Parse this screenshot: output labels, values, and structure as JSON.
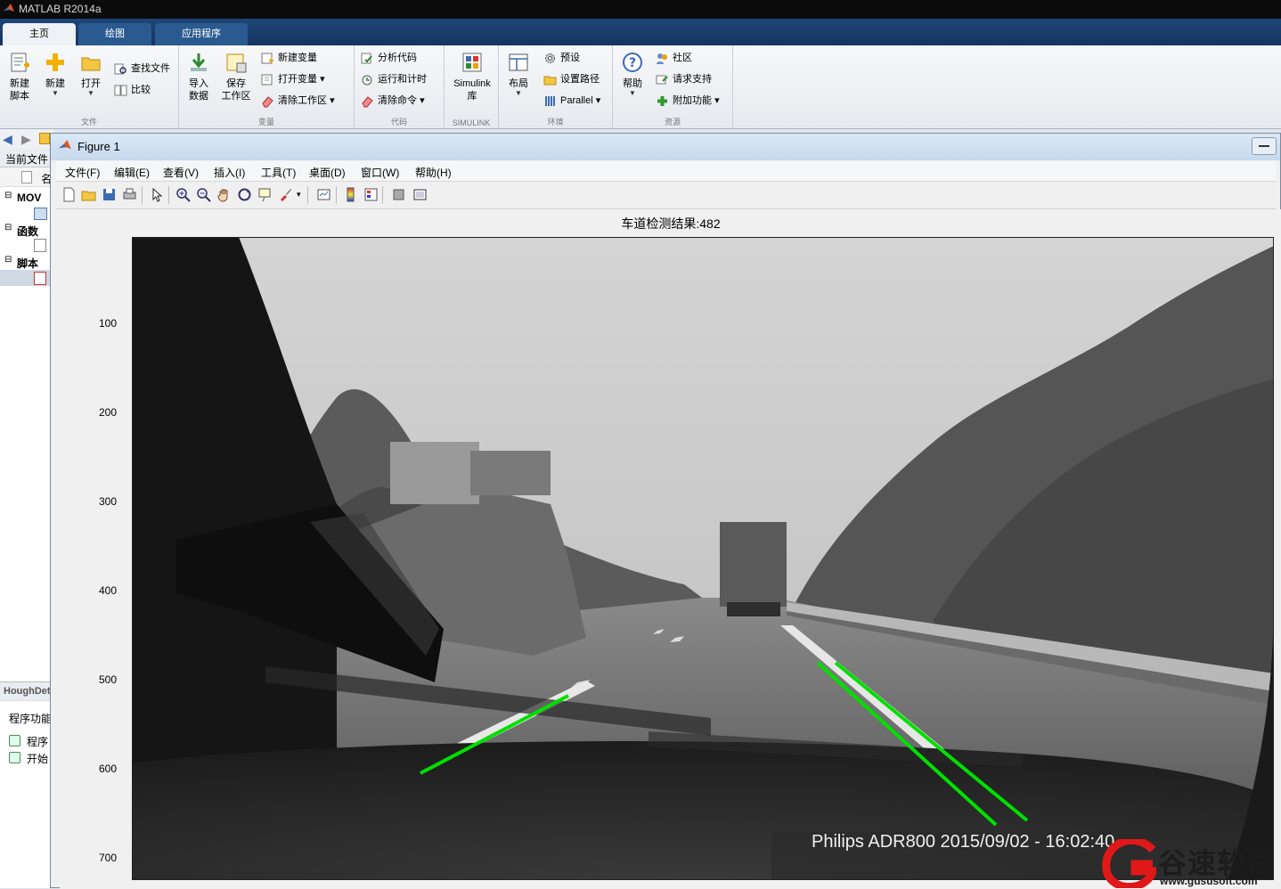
{
  "app": {
    "title": "MATLAB R2014a"
  },
  "tabs": [
    {
      "label": "主页"
    },
    {
      "label": "绘图"
    },
    {
      "label": "应用程序"
    }
  ],
  "ribbon": {
    "file": {
      "label": "文件",
      "new_script": "新建\n脚本",
      "new": "新建",
      "open": "打开",
      "find_files": "查找文件",
      "compare": "比较"
    },
    "variable": {
      "label": "变量",
      "import": "导入\n数据",
      "save": "保存\n工作区",
      "new_var": "新建变量",
      "open_var": "打开变量",
      "clear_ws": "清除工作区"
    },
    "code": {
      "label": "代码",
      "analyze": "分析代码",
      "run_time": "运行和计时",
      "clear_cmd": "清除命令"
    },
    "simulink": {
      "label": "SIMULINK",
      "btn": "Simulink\n库"
    },
    "environment": {
      "label": "环境",
      "layout": "布局",
      "prefs": "预设",
      "set_path": "设置路径",
      "parallel": "Parallel"
    },
    "resources": {
      "label": "资源",
      "help": "帮助",
      "community": "社区",
      "support": "请求支持",
      "addons": "附加功能"
    }
  },
  "left_panel": {
    "header": "当前文件",
    "col_name": "名",
    "folder": "MOV",
    "functions": "函数",
    "scripts": "脚本",
    "detail_title": "HoughDet",
    "detail_sub": "程序功能",
    "item1": "程序",
    "item2": "开始"
  },
  "figure": {
    "title": "Figure 1",
    "menu": [
      "文件(F)",
      "编辑(E)",
      "查看(V)",
      "插入(I)",
      "工具(T)",
      "桌面(D)",
      "窗口(W)",
      "帮助(H)"
    ],
    "plot_title": "车道检测结果:482",
    "yticks": [
      "100",
      "200",
      "300",
      "400",
      "500",
      "600",
      "700"
    ],
    "overlay_text": "Philips ADR800 2015/09/02 - 16:02:40"
  },
  "watermark": {
    "name": "谷速软件",
    "url": "www.gususoft.com"
  },
  "colors": {
    "lane_line": "#00e000",
    "title_bar": "#0b0b0b",
    "tab_strip": "#1e4677"
  }
}
